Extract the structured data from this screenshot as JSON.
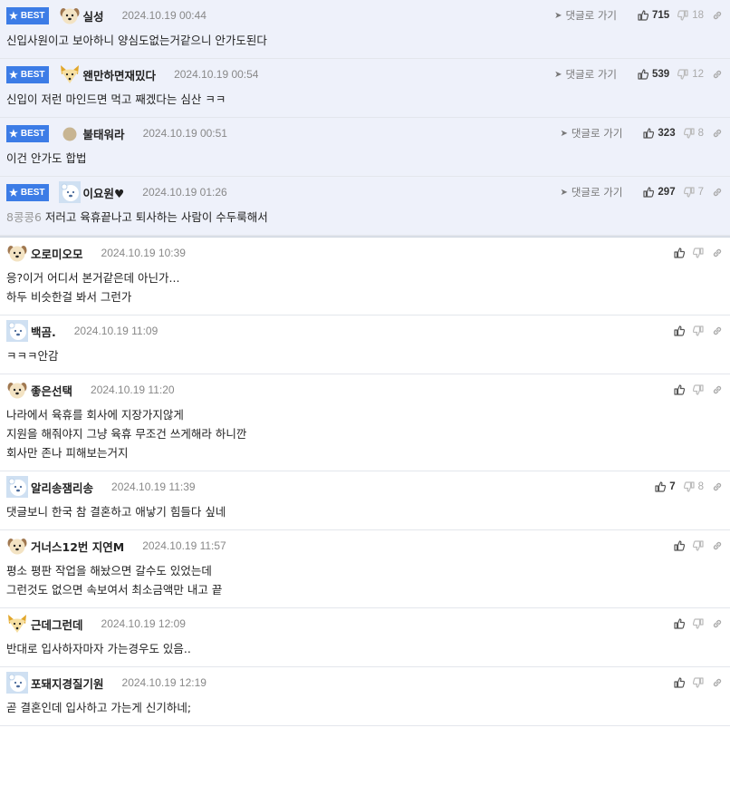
{
  "labels": {
    "best": "BEST",
    "goto_parent": "댓글로 가기"
  },
  "colors": {
    "best_badge": "#3c7ce6",
    "best_row_bg": "#eef1fa"
  },
  "best_comments": [
    {
      "nick": "실성",
      "avatar": "dog-cream",
      "date": "2024.10.19 00:44",
      "up": "715",
      "down": "18",
      "text": "신입사원이고 보아하니 양심도없는거같으니 안가도된다",
      "mention": ""
    },
    {
      "nick": "왠만하면재밌다",
      "avatar": "fox-yellow",
      "date": "2024.10.19 00:54",
      "up": "539",
      "down": "12",
      "text": "신입이 저런 마인드면 먹고 째겠다는 심산 ㅋㅋ",
      "mention": ""
    },
    {
      "nick": "불태워라",
      "avatar": "circle-tan",
      "date": "2024.10.19 00:51",
      "up": "323",
      "down": "8",
      "text": "이건 안가도 합법",
      "mention": ""
    },
    {
      "nick": "이요원♥",
      "avatar": "bear-blue",
      "date": "2024.10.19 01:26",
      "up": "297",
      "down": "7",
      "text": "저러고 육휴끝나고 퇴사하는 사람이 수두룩해서",
      "mention": "8콩콩6"
    }
  ],
  "comments": [
    {
      "nick": "오로미오모",
      "avatar": "dog-cream",
      "date": "2024.10.19 10:39",
      "up": "",
      "down": "",
      "lines": [
        "응?이거 어디서 본거같은데 아닌가...",
        "하두 비슷한걸 봐서 그런가"
      ]
    },
    {
      "nick": "백곰.",
      "avatar": "bear-blue",
      "date": "2024.10.19 11:09",
      "up": "",
      "down": "",
      "lines": [
        "ㅋㅋㅋ안감"
      ]
    },
    {
      "nick": "좋은선택",
      "avatar": "dog-cream",
      "date": "2024.10.19 11:20",
      "up": "",
      "down": "",
      "lines": [
        "나라에서 육휴를 회사에 지장가지않게",
        "지원을 해줘야지 그냥 육휴 무조건 쓰게해라 하니깐",
        "회사만 존나 피해보는거지"
      ]
    },
    {
      "nick": "알리송잼리송",
      "avatar": "bear-blue",
      "date": "2024.10.19 11:39",
      "up": "7",
      "down": "8",
      "lines": [
        "댓글보니 한국 참 결혼하고 애낳기 힘들다 싶네"
      ]
    },
    {
      "nick": "거너스12번 지연M",
      "avatar": "dog-cream",
      "date": "2024.10.19 11:57",
      "up": "",
      "down": "",
      "lines": [
        "평소 평판 작업을 해놨으면 갈수도 있었는데",
        "그런것도 없으면 속보여서 최소금액만 내고 끝"
      ]
    },
    {
      "nick": "근데그런데",
      "avatar": "fox-yellow",
      "date": "2024.10.19 12:09",
      "up": "",
      "down": "",
      "lines": [
        "반대로 입사하자마자 가는경우도 있음.."
      ]
    },
    {
      "nick": "포돼지경질기원",
      "avatar": "bear-blue",
      "date": "2024.10.19 12:19",
      "up": "",
      "down": "",
      "lines": [
        "곧 결혼인데 입사하고 가는게 신기하네;"
      ]
    }
  ]
}
